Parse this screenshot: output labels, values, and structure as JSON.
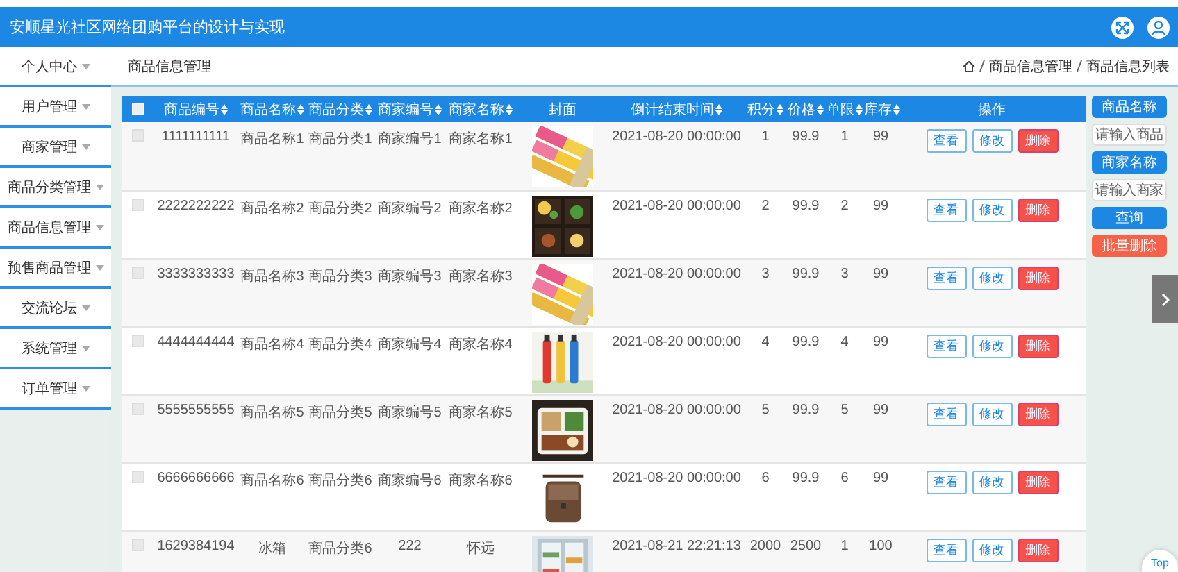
{
  "header": {
    "title": "安顺星光社区网络团购平台的设计与实现"
  },
  "sidebar": {
    "items": [
      {
        "label": "个人中心"
      },
      {
        "label": "用户管理"
      },
      {
        "label": "商家管理"
      },
      {
        "label": "商品分类管理"
      },
      {
        "label": "商品信息管理"
      },
      {
        "label": "预售商品管理"
      },
      {
        "label": "交流论坛"
      },
      {
        "label": "系统管理"
      },
      {
        "label": "订单管理"
      }
    ]
  },
  "breadcrumb": {
    "title": "商品信息管理",
    "path": [
      "商品信息管理",
      "商品信息列表"
    ]
  },
  "table": {
    "all_checked": false,
    "columns": [
      {
        "label": "商品编号",
        "sortable": true
      },
      {
        "label": "商品名称",
        "sortable": true
      },
      {
        "label": "商品分类",
        "sortable": true
      },
      {
        "label": "商家编号",
        "sortable": true
      },
      {
        "label": "商家名称",
        "sortable": true
      },
      {
        "label": "封面",
        "sortable": false
      },
      {
        "label": "倒计结束时间",
        "sortable": true
      },
      {
        "label": "积分",
        "sortable": true
      },
      {
        "label": "价格",
        "sortable": true
      },
      {
        "label": "单限",
        "sortable": true
      },
      {
        "label": "库存",
        "sortable": true
      },
      {
        "label": "操作",
        "sortable": false
      }
    ],
    "rows": [
      {
        "checked": false,
        "cells": [
          "1111111111",
          "商品名称1",
          "商品分类1",
          "商家编号1",
          "商家名称1",
          {
            "kind": "picture"
          },
          "2021-08-20 00:00:00",
          "1",
          "99.9",
          "1",
          "99"
        ],
        "actions": [
          {
            "label": "查看",
            "kind": "view"
          },
          {
            "label": "修改",
            "kind": "edit"
          },
          {
            "label": "删除",
            "kind": "delete"
          }
        ]
      },
      {
        "checked": false,
        "cells": [
          "2222222222",
          "商品名称2",
          "商品分类2",
          "商家编号2",
          "商家名称2",
          {
            "kind": "picture"
          },
          "2021-08-20 00:00:00",
          "2",
          "99.9",
          "2",
          "99"
        ],
        "actions": [
          {
            "label": "查看",
            "kind": "view"
          },
          {
            "label": "修改",
            "kind": "edit"
          },
          {
            "label": "删除",
            "kind": "delete"
          }
        ]
      },
      {
        "checked": false,
        "cells": [
          "3333333333",
          "商品名称3",
          "商品分类3",
          "商家编号3",
          "商家名称3",
          {
            "kind": "picture"
          },
          "2021-08-20 00:00:00",
          "3",
          "99.9",
          "3",
          "99"
        ],
        "actions": [
          {
            "label": "查看",
            "kind": "view"
          },
          {
            "label": "修改",
            "kind": "edit"
          },
          {
            "label": "删除",
            "kind": "delete"
          }
        ]
      },
      {
        "checked": false,
        "cells": [
          "4444444444",
          "商品名称4",
          "商品分类4",
          "商家编号4",
          "商家名称4",
          {
            "kind": "picture"
          },
          "2021-08-20 00:00:00",
          "4",
          "99.9",
          "4",
          "99"
        ],
        "actions": [
          {
            "label": "查看",
            "kind": "view"
          },
          {
            "label": "修改",
            "kind": "edit"
          },
          {
            "label": "删除",
            "kind": "delete"
          }
        ]
      },
      {
        "checked": false,
        "cells": [
          "5555555555",
          "商品名称5",
          "商品分类5",
          "商家编号5",
          "商家名称5",
          {
            "kind": "picture"
          },
          "2021-08-20 00:00:00",
          "5",
          "99.9",
          "5",
          "99"
        ],
        "actions": [
          {
            "label": "查看",
            "kind": "view"
          },
          {
            "label": "修改",
            "kind": "edit"
          },
          {
            "label": "删除",
            "kind": "delete"
          }
        ]
      },
      {
        "checked": false,
        "cells": [
          "6666666666",
          "商品名称6",
          "商品分类6",
          "商家编号6",
          "商家名称6",
          {
            "kind": "picture"
          },
          "2021-08-20 00:00:00",
          "6",
          "99.9",
          "6",
          "99"
        ],
        "actions": [
          {
            "label": "查看",
            "kind": "view"
          },
          {
            "label": "修改",
            "kind": "edit"
          },
          {
            "label": "删除",
            "kind": "delete"
          }
        ]
      },
      {
        "checked": false,
        "cells": [
          "1629384194",
          "冰箱",
          "商品分类6",
          "222",
          "怀远",
          {
            "kind": "picture"
          },
          "2021-08-21 22:21:13",
          "2000",
          "2500",
          "1",
          "100"
        ],
        "actions": [
          {
            "label": "查看",
            "kind": "view"
          },
          {
            "label": "修改",
            "kind": "edit"
          },
          {
            "label": "删除",
            "kind": "delete"
          }
        ]
      }
    ]
  },
  "search": {
    "fields": [
      {
        "label": "商品名称",
        "placeholder": "请输入商品"
      },
      {
        "label": "商家名称",
        "placeholder": "请输入商家"
      }
    ],
    "buttons": [
      {
        "label": "查询",
        "kind": "search"
      },
      {
        "label": "批量删除",
        "kind": "danger"
      }
    ]
  },
  "back_to_top": {
    "label": "Top"
  }
}
